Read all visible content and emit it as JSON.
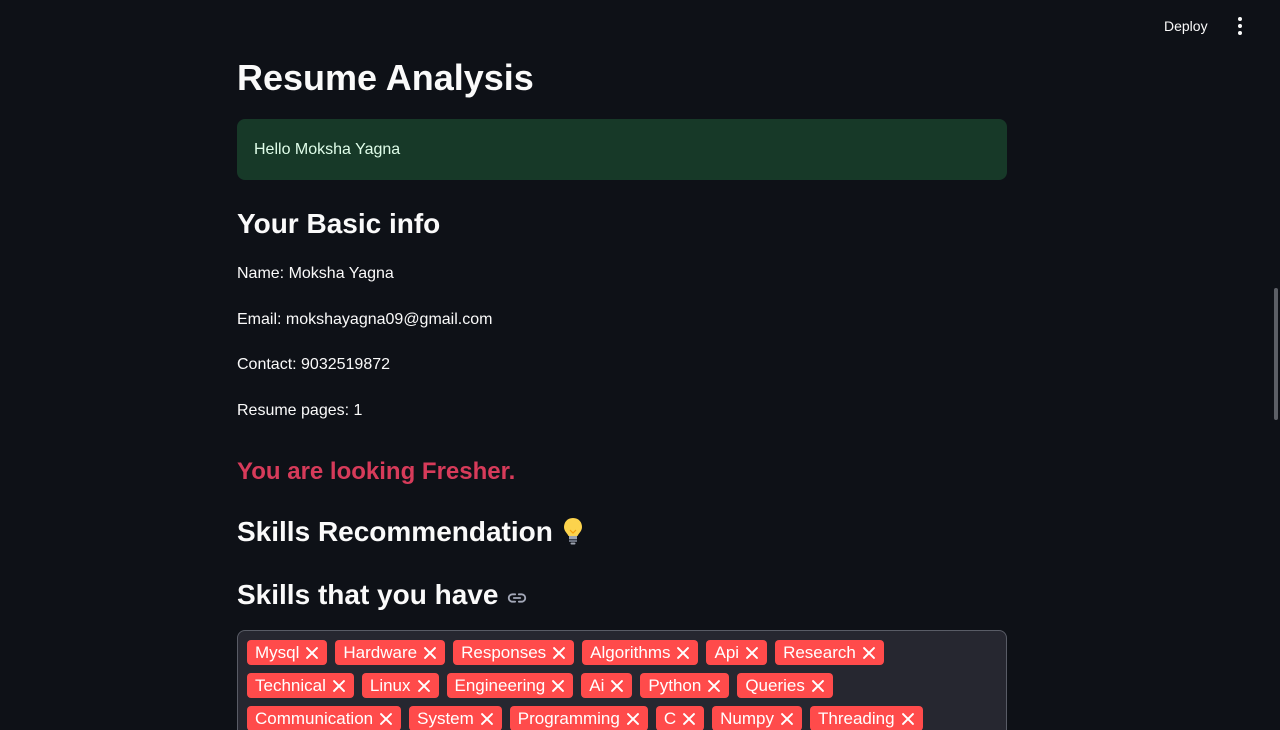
{
  "header": {
    "deploy_label": "Deploy",
    "menu_icon": "three-dots-vertical-icon"
  },
  "main": {
    "title": "Resume Analysis",
    "greeting": "Hello Moksha Yagna",
    "basic_info_heading": "Your Basic info",
    "name_line": "Name: Moksha Yagna",
    "email_line": "Email: mokshayagna09@gmail.com",
    "contact_line": "Contact: 9032519872",
    "pages_line": "Resume pages: 1",
    "level_message": "You are looking Fresher.",
    "skills_recommendation_heading": "Skills Recommendation",
    "skills_have_heading": "Skills that you have",
    "skill_rows": [
      [
        "Mysql",
        "Hardware",
        "Responses",
        "Algorithms",
        "Api",
        "Research"
      ],
      [
        "Technical",
        "Linux",
        "Engineering",
        "Ai",
        "Python",
        "Queries"
      ],
      [
        "Communication",
        "System",
        "Programming",
        "C",
        "Numpy",
        "Threading"
      ]
    ]
  },
  "colors": {
    "background": "#0e1117",
    "success_bg": "#173928",
    "fresher_text": "#d73b5a",
    "tag_bg": "#ff4b4b"
  }
}
